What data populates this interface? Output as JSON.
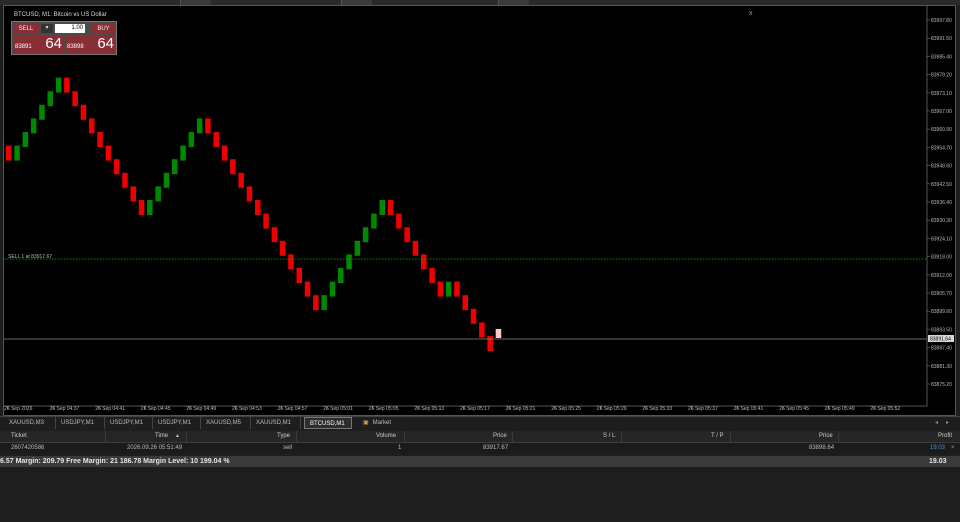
{
  "chart": {
    "symbol_desc": "BTCUSD, M1: Bitcoin vs US Dollar",
    "close_icon": "x",
    "level_label": "SELL 1 at 83917.67",
    "level_color": "#22aa22",
    "current_price_tag": "83891.64",
    "bull_color": "#008800",
    "bear_color": "#ee0000",
    "last_color": "#ffcccc",
    "y_labels": [
      "83997.80",
      "83991.50",
      "83985.40",
      "83979.20",
      "83973.10",
      "83967.00",
      "83960.90",
      "83954.70",
      "83948.60",
      "83942.50",
      "83936.40",
      "83930.30",
      "83924.10",
      "83918.00",
      "83912.00",
      "83905.70",
      "83899.60",
      "83893.50",
      "83887.40",
      "83881.30",
      "83875.20"
    ],
    "x_labels": [
      "26 Sep 2026",
      "26 Sep 04:37",
      "26 Sep 04:41",
      "26 Sep 04:45",
      "26 Sep 04:49",
      "26 Sep 04:53",
      "26 Sep 04:57",
      "26 Sep 05:01",
      "26 Sep 05:05",
      "26 Sep 05:13",
      "26 Sep 05:17",
      "26 Sep 05:21",
      "26 Sep 05:25",
      "26 Sep 05:29",
      "26 Sep 05:33",
      "26 Sep 05:37",
      "26 Sep 05:41",
      "26 Sep 05:45",
      "26 Sep 05:49",
      "26 Sep 05:52"
    ]
  },
  "trade_panel": {
    "sell_label": "SELL",
    "buy_label": "BUY",
    "lot": "1.00",
    "lot_minus": "▾",
    "sell_price_small": "83891",
    "sell_price_big": "64",
    "buy_price_small": "83898",
    "buy_price_big": "64"
  },
  "tabs": [
    {
      "label": "XAUUSD,M3",
      "active": false
    },
    {
      "label": "USDJPY,M1",
      "active": false
    },
    {
      "label": "USDJPY,M1",
      "active": false
    },
    {
      "label": "USDJPY,M1",
      "active": false
    },
    {
      "label": "XAUUSD,M5",
      "active": false
    },
    {
      "label": "XAUUSD,M1",
      "active": false
    },
    {
      "label": "BTCUSD,M1",
      "active": true
    },
    {
      "label": "Market",
      "active": false
    }
  ],
  "tab_scroll": {
    "left": "◂",
    "right": "▸"
  },
  "table": {
    "headers": {
      "ticket": "Ticket",
      "time": "Time",
      "sort_icon": "▲",
      "type": "Type",
      "volume": "Volume",
      "price": "Price",
      "sl": "S / L",
      "tp": "T / P",
      "price2": "Price",
      "profit": "Profit"
    },
    "row": {
      "ticket": "2607420586",
      "time": "2026.09.26 05:51:49",
      "type": "sell",
      "volume": "1",
      "price": "83917.67",
      "price2": "83898.64",
      "profit": "19.03",
      "profit_color": "#4a8fe0",
      "close_icon": "×"
    },
    "margin_line": "6.57  Margin: 209.79  Free Margin: 21 186.78  Margin Level: 10 199.04 %",
    "total_profit": "19.03"
  }
}
